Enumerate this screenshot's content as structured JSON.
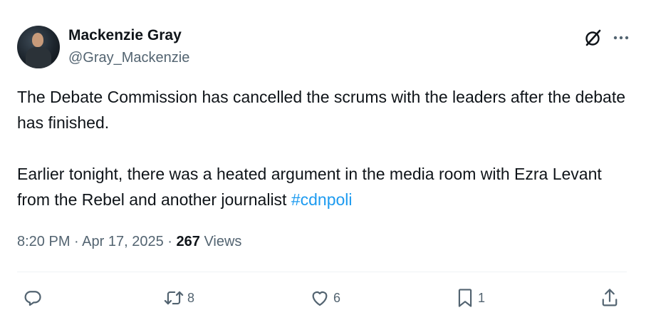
{
  "post": {
    "author": {
      "name": "Mackenzie Gray",
      "handle": "@Gray_Mackenzie"
    },
    "text_paragraph_1": "The Debate Commission has cancelled the scrums with the leaders after the debate has finished.",
    "text_paragraph_2": "Earlier tonight, there was a heated argument in the media room with Ezra Levant from the Rebel and another journalist",
    "hashtag": "#cdnpoli",
    "time": "8:20 PM",
    "date": "Apr 17, 2025",
    "separator": "·",
    "views_count": "267",
    "views_label": "Views"
  },
  "actions": {
    "replies": "",
    "reposts": "8",
    "likes": "6",
    "bookmarks": "1"
  },
  "icons": {
    "grok": "grok-icon",
    "more": "more-icon",
    "reply": "reply-icon",
    "repost": "repost-icon",
    "like": "heart-icon",
    "bookmark": "bookmark-icon",
    "share": "share-icon"
  },
  "colors": {
    "text": "#0f1419",
    "secondary": "#536471",
    "link": "#1d9bf0",
    "divider": "#eff3f4"
  }
}
